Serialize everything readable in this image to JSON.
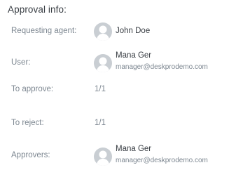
{
  "title": "Approval info:",
  "requesting_agent": {
    "label": "Requesting agent:",
    "name": "John Doe",
    "avatar_icon": "default-user-avatar-icon"
  },
  "user": {
    "label": "User:",
    "name": "Mana Ger",
    "email": "manager@deskprodemo.com",
    "avatar_icon": "default-user-avatar-icon"
  },
  "to_approve": {
    "label": "To approve:",
    "value": "1/1"
  },
  "to_reject": {
    "label": "To reject:",
    "value": "1/1"
  },
  "approvers": {
    "label": "Approvers:",
    "items": [
      {
        "name": "Mana Ger",
        "email": "manager@deskprodemo.com",
        "avatar_icon": "default-user-avatar-icon"
      }
    ]
  },
  "colors": {
    "label_text": "#7d8791",
    "name_text": "#373c42",
    "avatar_bg": "#c9ced3",
    "avatar_fg": "#ffffff"
  }
}
